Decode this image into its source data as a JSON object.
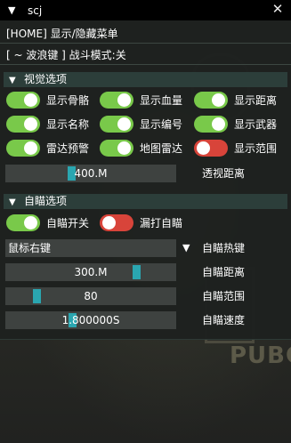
{
  "window": {
    "title": "scj",
    "collapse_icon": "triangle-down-icon",
    "close_icon": "close-icon"
  },
  "background": {
    "watermark": "PUBG"
  },
  "menu": {
    "home_row": "[HOME] 显示/隐藏菜单",
    "wave_row": "[ ~  波浪键 ] 战斗模式:关"
  },
  "visual": {
    "title": "视觉选项",
    "toggles": [
      {
        "label": "显示骨骼",
        "on": true
      },
      {
        "label": "显示血量",
        "on": true
      },
      {
        "label": "显示距离",
        "on": true
      },
      {
        "label": "显示名称",
        "on": true
      },
      {
        "label": "显示编号",
        "on": true
      },
      {
        "label": "显示武器",
        "on": true
      },
      {
        "label": "雷达预警",
        "on": true
      },
      {
        "label": "地图雷达",
        "on": true
      },
      {
        "label": "显示范围",
        "on": false
      }
    ],
    "distance": {
      "value": "400.M",
      "label": "透视距离",
      "fraction": 0.38
    }
  },
  "aim": {
    "title": "自瞄选项",
    "toggles": [
      {
        "label": "自瞄开关",
        "on": true
      },
      {
        "label": "漏打自瞄",
        "on": false
      }
    ],
    "hotkey": {
      "value": "鼠标右键",
      "label": "自瞄热键"
    },
    "distance": {
      "value": "300.M",
      "label": "自瞄距离",
      "fraction": 0.78
    },
    "range": {
      "value": "80",
      "label": "自瞄范围",
      "fraction": 0.17
    },
    "speed": {
      "value": "1.800000S",
      "label": "自瞄速度",
      "fraction": 0.39
    }
  },
  "colors": {
    "switch_on": "#79c94a",
    "switch_off": "#d8443a",
    "slider_thumb": "#2aa6b0",
    "section_header": "#2c3e3a"
  }
}
